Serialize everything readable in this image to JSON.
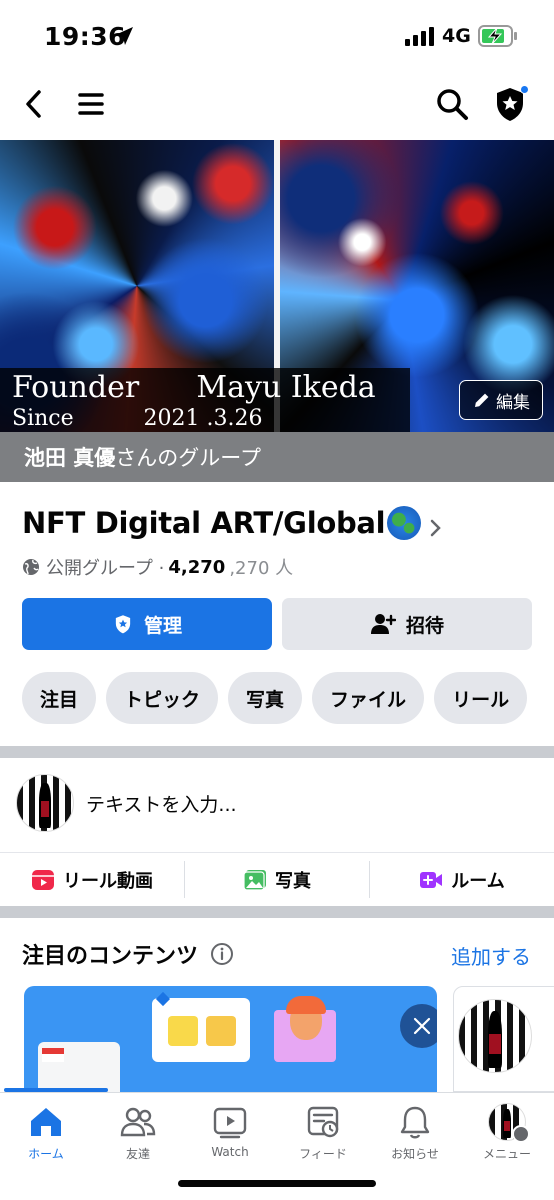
{
  "status_bar": {
    "time": "19:36",
    "network": "4G"
  },
  "cover": {
    "caption_line1": "Founder      Mayu Ikeda",
    "caption_line2": "Since          2021 .3.26",
    "edit_label": "編集",
    "owner_name": "池田 真優",
    "owner_suffix": "さんのグループ"
  },
  "group": {
    "name": "NFT Digital ART/Global",
    "privacy": "公開グループ · ",
    "member_count": "4,270",
    "member_count_faded": ",270 人"
  },
  "buttons": {
    "manage": "管理",
    "invite": "招待"
  },
  "chips": [
    "注目",
    "トピック",
    "写真",
    "ファイル",
    "リール"
  ],
  "composer": {
    "placeholder": "テキストを入力..."
  },
  "composer_actions": [
    {
      "label": "リール動画",
      "color": "#f0284a"
    },
    {
      "label": "写真",
      "color": "#45bd62"
    },
    {
      "label": "ルーム",
      "color": "#a033ff"
    }
  ],
  "featured": {
    "title": "注目のコンテンツ",
    "add_label": "追加する"
  },
  "tabs": [
    {
      "label": "ホーム",
      "active": true
    },
    {
      "label": "友達"
    },
    {
      "label": "Watch"
    },
    {
      "label": "フィード"
    },
    {
      "label": "お知らせ"
    },
    {
      "label": "メニュー"
    }
  ],
  "colors": {
    "accent": "#1b74e4",
    "secondary_button": "#e4e6eb",
    "muted_text": "#65676b"
  }
}
